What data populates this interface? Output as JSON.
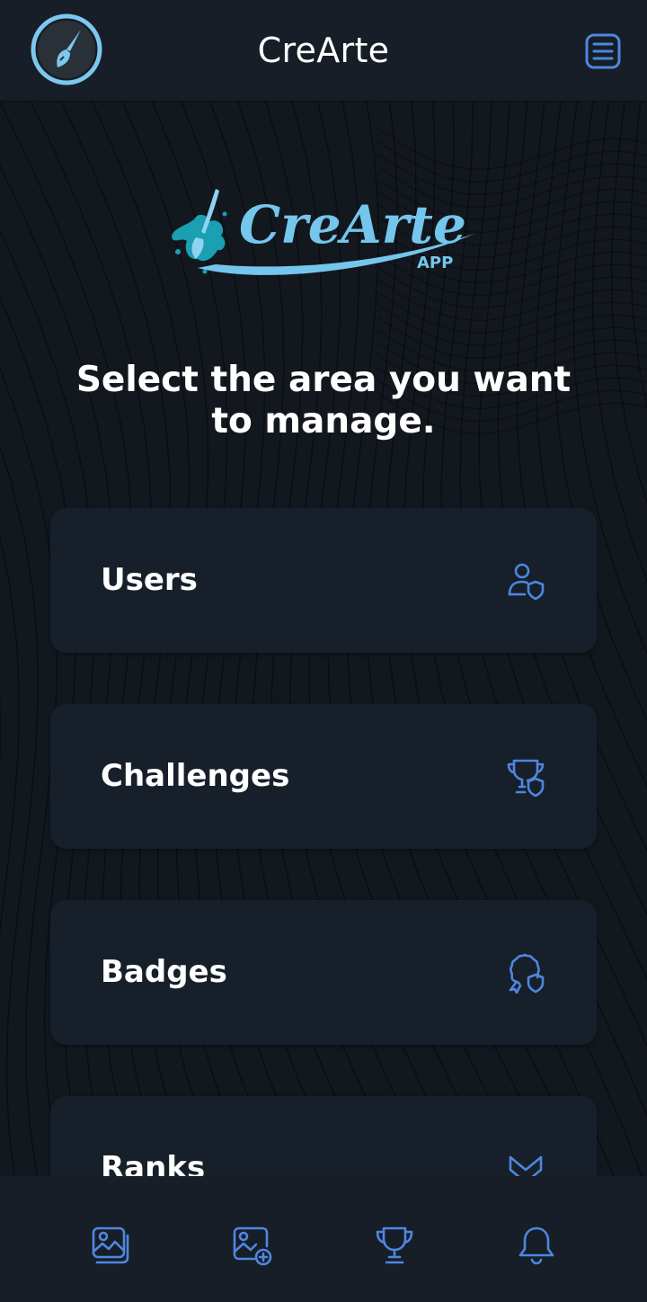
{
  "header": {
    "title": "CreArte"
  },
  "brand": {
    "name": "CreArte",
    "sub": "APP"
  },
  "main": {
    "heading": "Select the area you want to manage."
  },
  "cards": [
    {
      "label": "Users",
      "icon": "user-shield-icon"
    },
    {
      "label": "Challenges",
      "icon": "trophy-shield-icon"
    },
    {
      "label": "Badges",
      "icon": "badge-shield-icon"
    },
    {
      "label": "Ranks",
      "icon": "rank-icon"
    }
  ],
  "bottom_nav": [
    {
      "icon": "gallery-icon"
    },
    {
      "icon": "add-image-icon"
    },
    {
      "icon": "trophy-icon"
    },
    {
      "icon": "bell-icon"
    }
  ],
  "colors": {
    "accent": "#4f86e0",
    "logo_blue": "#74c6ec",
    "card_bg": "#17202a",
    "bar_bg": "#171e27"
  }
}
